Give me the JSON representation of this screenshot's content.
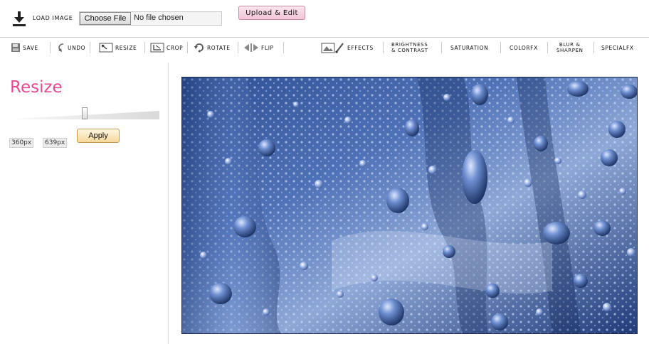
{
  "header": {
    "load_label": "LOAD IMAGE",
    "choose_file_label": "Choose File",
    "file_status": "No file chosen",
    "upload_label": "Upload & Edit"
  },
  "toolbar": {
    "save": "SAVE",
    "undo": "UNDO",
    "resize": "RESIZE",
    "crop": "CROP",
    "rotate": "ROTATE",
    "flip": "FLIP",
    "effects": "EFFECTS",
    "brightness_line1": "BRIGHTNESS",
    "brightness_line2": "& CONTRAST",
    "saturation": "SATURATION",
    "colorfx": "COLORFX",
    "blur_line1": "BLUR &",
    "blur_line2": "SHARPEN",
    "specialfx": "SPECIALFX"
  },
  "resize_panel": {
    "title": "Resize",
    "width_value": "360px",
    "height_value": "639px",
    "apply_label": "Apply",
    "slider_position": 0.47
  },
  "colors": {
    "accent": "#e34b8f",
    "upload_bg": "#f3c5d8",
    "apply_bg": "#f6d79a"
  },
  "icons": {
    "load": "download-icon",
    "save": "floppy-icon",
    "undo": "undo-icon",
    "resize": "resize-icon",
    "crop": "crop-icon",
    "rotate": "rotate-icon",
    "flip": "flip-icon",
    "effects": "image-brush-icon"
  }
}
